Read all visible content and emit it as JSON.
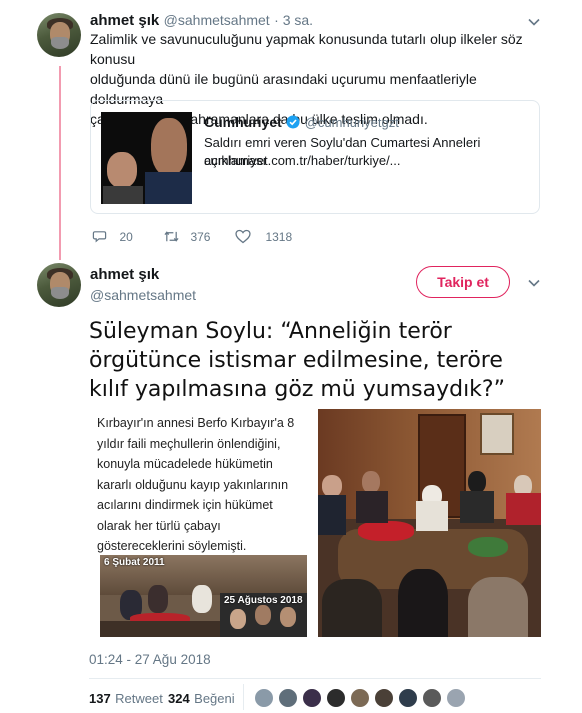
{
  "tweet1": {
    "name": "ahmet şık",
    "handle": "@sahmetsahmet",
    "time": "· 3 sa.",
    "text_lines": [
      "Zalimlik ve savunuculuğunu yapmak konusunda tutarlı olup ilkeler söz konusu",
      "olduğunda dünü ile bugünü arasındaki uçurumu menfaatleriyle doldurmaya",
      "çalışan naylon kahramanlara da bu ülke teslim olmadı."
    ],
    "card": {
      "source": "Cumhuriyet",
      "handle": "@cumhuriyetgzt",
      "title": "Saldırı emri veren Soylu'dan Cumartesi Anneleri açıklaması",
      "url": "cumhuriyet.com.tr/haber/turkiye/..."
    },
    "replies": "20",
    "retweets": "376",
    "likes": "1318"
  },
  "tweet2": {
    "name": "ahmet şık",
    "handle": "@sahmetsahmet",
    "follow_label": "Takip et",
    "headline_lines": [
      "Süleyman Soylu: “Anneliğin terör",
      "örgütünce istismar edilmesine, teröre",
      "kılıf yapılmasına göz mü yumsaydık?”"
    ],
    "article_lines": [
      "Kırbayır'ın annesi Berfo Kırbayır'a 8",
      "yıldır faili meçhullerin önlendiğini,",
      "konuyla mücadelede hükümetin",
      "kararlı olduğunu kayıp yakınlarının",
      "acılarını dindirmek için hükümet",
      "olarak her türlü çabayı",
      "göstereceklerini söylemişti."
    ],
    "photo_date_1": "6 Şubat 2011",
    "photo_date_2": "25 Ağustos 2018",
    "timestamp": "01:24 - 27 Ağu 2018",
    "retweet_count": "137",
    "retweet_label": "Retweet",
    "like_count": "324",
    "like_label": "Beğeni"
  },
  "colors": {
    "accent": "#e0245e",
    "muted": "#657786",
    "verified": "#1da1f2",
    "thread": "#f29bb0"
  },
  "icons": [
    "chevron-down-icon",
    "reply-icon",
    "retweet-icon",
    "heart-icon",
    "verified-icon"
  ]
}
